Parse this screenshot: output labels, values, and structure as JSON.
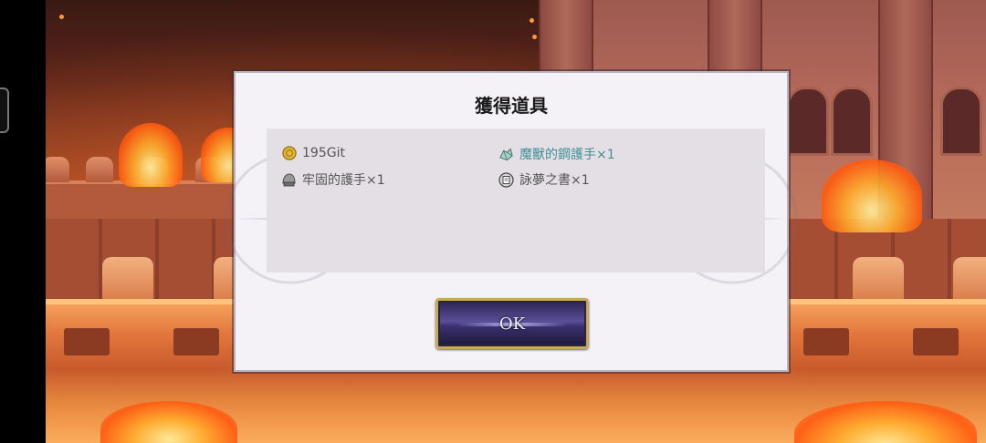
{
  "dialog": {
    "title": "獲得道具",
    "ok_label": "OK"
  },
  "items": [
    {
      "icon": "coin-icon",
      "label": "195Git",
      "rarity": "normal"
    },
    {
      "icon": "crystal-ore-icon",
      "label": "魔獸的鋼護手×1",
      "rarity": "rare"
    },
    {
      "icon": "helmet-icon",
      "label": "牢固的護手×1",
      "rarity": "normal"
    },
    {
      "icon": "book-icon",
      "label": "詠夢之書×1",
      "rarity": "normal"
    }
  ],
  "colors": {
    "rare_text": "#3f8f95",
    "normal_text": "#555555",
    "button_border": "#c7a956"
  }
}
